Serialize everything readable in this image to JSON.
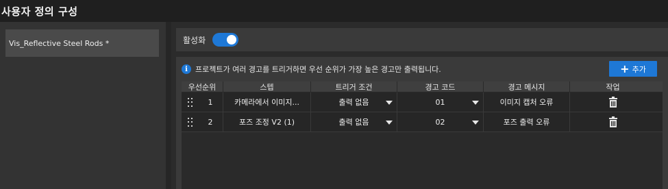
{
  "window": {
    "title": "사용자 정의 구성"
  },
  "sidebar": {
    "items": [
      {
        "label": "Vis_Reflective Steel Rods *"
      }
    ]
  },
  "activation": {
    "label": "활성화",
    "enabled": true,
    "toggle_color": "#1e78d6"
  },
  "info": {
    "icon": "info-icon",
    "text": "프로젝트가 여러 경고를 트리거하면 우선 순위가 가장 높은 경고만 출력됩니다."
  },
  "add_button": {
    "label": "추가",
    "icon": "plus-icon"
  },
  "table": {
    "headers": [
      "우선순위",
      "스텝",
      "트리거 조건",
      "경고 코드",
      "경고 메시지",
      "작업"
    ],
    "rows": [
      {
        "rank": "1",
        "step": "카메라에서 이미지...",
        "trigger": "출력 없음",
        "code": "01",
        "message": "이미지 캡처 오류"
      },
      {
        "rank": "2",
        "step": "포즈 조정 V2 (1)",
        "trigger": "출력 없음",
        "code": "02",
        "message": "포즈 출력 오류"
      }
    ]
  }
}
